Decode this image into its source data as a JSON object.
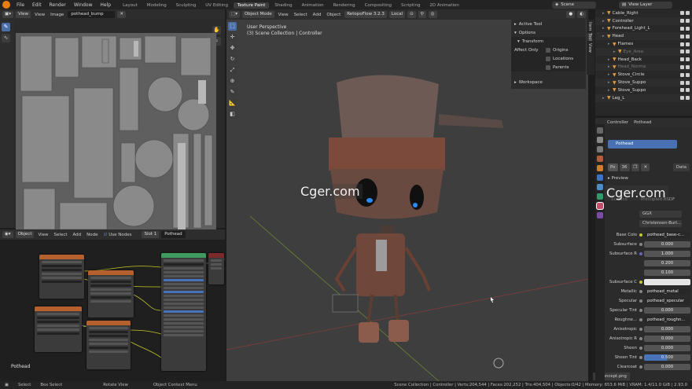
{
  "topbar": {
    "menus": [
      "File",
      "Edit",
      "Render",
      "Window",
      "Help"
    ],
    "workspaces": [
      "Layout",
      "Modeling",
      "Sculpting",
      "UV Editing",
      "Texture Paint",
      "Shading",
      "Animation",
      "Rendering",
      "Compositing",
      "Scripting",
      "2D Animation"
    ],
    "active_workspace": "Texture Paint",
    "scene": "Scene",
    "view_layer": "View Layer"
  },
  "image_editor": {
    "menus": [
      "View",
      "View",
      "Image"
    ],
    "image_name": "pothead_bump"
  },
  "node_editor": {
    "type": "Object",
    "menus": [
      "View",
      "Select",
      "Add",
      "Node"
    ],
    "use_nodes": "Use Nodes",
    "slot": "Slot 1",
    "material": "Pothead",
    "label": "Pothead"
  },
  "viewport": {
    "mode": "Object Mode",
    "menus": [
      "View",
      "Select",
      "Add",
      "Object"
    ],
    "addon": "RetopoFlow 3.2.3",
    "orientation": "Local",
    "view_name": "User Perspective",
    "collection": "(3) Scene Collection | Controller"
  },
  "npanel": {
    "active_tool": "Active Tool",
    "options": "Options",
    "transform": "Transform",
    "affect_only": "Affect Only",
    "checks": [
      "Origins",
      "Locations",
      "Parents"
    ],
    "workspace": "Workspace",
    "tabs": [
      "Item",
      "Tool",
      "View"
    ]
  },
  "outliner": {
    "rows": [
      {
        "name": "Cable_Right",
        "depth": 1,
        "dim": false
      },
      {
        "name": "Controller",
        "depth": 1,
        "dim": false
      },
      {
        "name": "Forehead_Light_L",
        "depth": 1,
        "dim": false
      },
      {
        "name": "Head",
        "depth": 1,
        "dim": false
      },
      {
        "name": "Flames",
        "depth": 2,
        "dim": false
      },
      {
        "name": "Eye_Area",
        "depth": 3,
        "dim": true
      },
      {
        "name": "Head_Back",
        "depth": 2,
        "dim": false
      },
      {
        "name": "Head_Norma",
        "depth": 2,
        "dim": true
      },
      {
        "name": "Stove_Circle",
        "depth": 2,
        "dim": false
      },
      {
        "name": "Stove_Suppo",
        "depth": 2,
        "dim": false
      },
      {
        "name": "Stove_Suppo",
        "depth": 2,
        "dim": false
      },
      {
        "name": "Leg_L",
        "depth": 1,
        "dim": false
      }
    ]
  },
  "properties": {
    "object": "Controller",
    "material": "Pothead",
    "slot_item": "Pothead",
    "mat_name": "Po",
    "users": "36",
    "data": "Data",
    "preview": "Preview",
    "surface": "Surface",
    "shader": "Principled BSDF",
    "distribution": "GGX",
    "subsurface_method": "Christensen-Burl...",
    "rows": [
      {
        "label": "Base Colo",
        "value": "pothead_base-c...",
        "tex": true,
        "dot": "y"
      },
      {
        "label": "Subsurface",
        "value": "0.000",
        "tex": false,
        "dot": "g"
      },
      {
        "label": "Subsurface R",
        "value": "1.000",
        "tex": false,
        "dot": "v"
      },
      {
        "label": "",
        "value": "0.200",
        "tex": false,
        "dot": ""
      },
      {
        "label": "",
        "value": "0.100",
        "tex": false,
        "dot": ""
      },
      {
        "label": "Subsurface C",
        "value": "",
        "tex": false,
        "dot": "y"
      },
      {
        "label": "Metallic",
        "value": "pothead_metal",
        "tex": true,
        "dot": "g"
      },
      {
        "label": "Specular",
        "value": "pothead_specular",
        "tex": true,
        "dot": "g"
      },
      {
        "label": "Specular Tint",
        "value": "0.000",
        "tex": false,
        "dot": "g"
      },
      {
        "label": "Roughne...",
        "value": "pothead_roughn...",
        "tex": true,
        "dot": "g"
      },
      {
        "label": "Anisotropic",
        "value": "0.000",
        "tex": false,
        "dot": "g"
      },
      {
        "label": "Anisotropic R",
        "value": "0.000",
        "tex": false,
        "dot": "g"
      },
      {
        "label": "Sheen",
        "value": "0.000",
        "tex": false,
        "dot": "g"
      },
      {
        "label": "Sheen Tint",
        "value": "0.500",
        "tex": false,
        "dot": "g"
      },
      {
        "label": "Clearcoat",
        "value": "0.000",
        "tex": false,
        "dot": "g"
      }
    ],
    "image_tab": "d_concept.png"
  },
  "statusbar": {
    "items": [
      "Select",
      "Box Select",
      "Rotate View",
      "Object Context Menu"
    ],
    "stats": "Scene Collection | Controller | Verts:204,544 | Faces:202,252 | Tris:404,504 | Objects:0/42 | Memory: 653.6 MiB | VRAM: 1.4/11.0 GiB | 2.93.0"
  },
  "watermark": "Cger.com"
}
